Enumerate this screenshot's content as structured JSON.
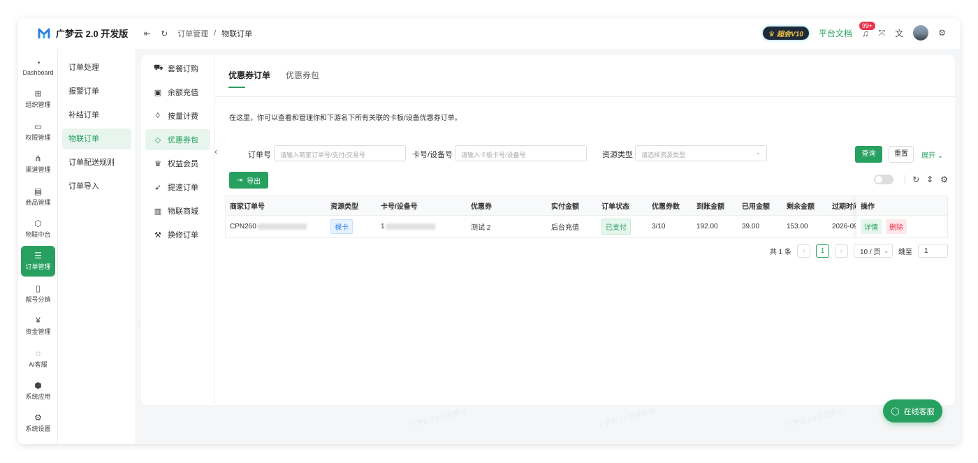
{
  "app": {
    "title": "广梦云 2.0 开发版",
    "watermark": "广梦云 2.0 开发版 v1"
  },
  "topbar": {
    "breadcrumb": [
      "订单管理",
      "物联订单"
    ],
    "vip_badge": "超会V10",
    "docs_label": "平台文档",
    "notif_count": "99+"
  },
  "rail": [
    {
      "label": "Dashboard",
      "icon": "dashboard-icon",
      "glyph": "◔"
    },
    {
      "label": "组织管理",
      "icon": "grid-icon",
      "glyph": "⊞"
    },
    {
      "label": "权限管理",
      "icon": "monitor-icon",
      "glyph": "▭"
    },
    {
      "label": "渠道管理",
      "icon": "network-icon",
      "glyph": "⋔"
    },
    {
      "label": "商品管理",
      "icon": "store-icon",
      "glyph": "▤"
    },
    {
      "label": "物联中台",
      "icon": "cube-icon",
      "glyph": "⬡"
    },
    {
      "label": "订单管理",
      "icon": "list-icon",
      "glyph": "☰"
    },
    {
      "label": "靓号分销",
      "icon": "phone-icon",
      "glyph": "▯"
    },
    {
      "label": "资金管理",
      "icon": "yen-icon",
      "glyph": "¥"
    },
    {
      "label": "AI客服",
      "icon": "ai-icon",
      "glyph": "◌"
    },
    {
      "label": "系统应用",
      "icon": "package-icon",
      "glyph": "⬢"
    },
    {
      "label": "系统设置",
      "icon": "gear-icon",
      "glyph": "⚙"
    }
  ],
  "subnav": [
    "订单处理",
    "报警订单",
    "补结订单",
    "物联订单",
    "订单配送规则",
    "订单导入"
  ],
  "menu3": [
    {
      "label": "套餐订购",
      "icon": "cart-icon",
      "glyph": "🛒"
    },
    {
      "label": "余额充值",
      "icon": "wallet-icon",
      "glyph": "▣"
    },
    {
      "label": "按量计费",
      "icon": "drop-icon",
      "glyph": "◊"
    },
    {
      "label": "优惠券包",
      "icon": "coupon-icon",
      "glyph": "◇"
    },
    {
      "label": "权益会员",
      "icon": "crown-icon",
      "glyph": "♛"
    },
    {
      "label": "提速订单",
      "icon": "rocket-icon",
      "glyph": "➶"
    },
    {
      "label": "物联商城",
      "icon": "book-icon",
      "glyph": "▥"
    },
    {
      "label": "换修订单",
      "icon": "hammer-icon",
      "glyph": "⚒"
    }
  ],
  "tabs": [
    "优惠券订单",
    "优惠券包"
  ],
  "description": "在这里，你可以查看和管理你和下游名下所有关联的卡板/设备优惠券订单。",
  "filters": {
    "order_no_label": "订单号",
    "order_no_placeholder": "请输入商家订单号/支付/交易号",
    "card_label": "卡号/设备号",
    "card_placeholder": "请输入卡板卡号/设备号",
    "resource_label": "资源类型",
    "resource_placeholder": "请选择资源类型",
    "query_label": "查询",
    "reset_label": "重置",
    "expand_label": "展开"
  },
  "export_label": "导出",
  "table": {
    "columns": [
      "商家订单号",
      "资源类型",
      "卡号/设备号",
      "优惠券",
      "实付金额",
      "订单状态",
      "优惠券数",
      "到账金额",
      "已用金额",
      "剩余金额",
      "过期时间"
    ],
    "action_header": "操作",
    "rows": [
      {
        "order_no": "CPN260",
        "resource_type": "裸卡",
        "card_no": "1",
        "coupon": "测试 2",
        "paid": "后台充值",
        "status": "已支付",
        "coupon_count": "3/10",
        "received": "192.00",
        "used": "39.00",
        "remaining": "153.00",
        "expire": "2026-09",
        "detail_label": "详情",
        "delete_label": "删除"
      }
    ]
  },
  "pagination": {
    "total_text": "共 1 条",
    "current_page": "1",
    "page_size": "10 / 页",
    "jump_label": "跳至",
    "jump_value": "1"
  },
  "chat_label": "在线客服",
  "colors": {
    "accent": "#27a060",
    "danger": "#e8334a",
    "info": "#3d8be6"
  }
}
